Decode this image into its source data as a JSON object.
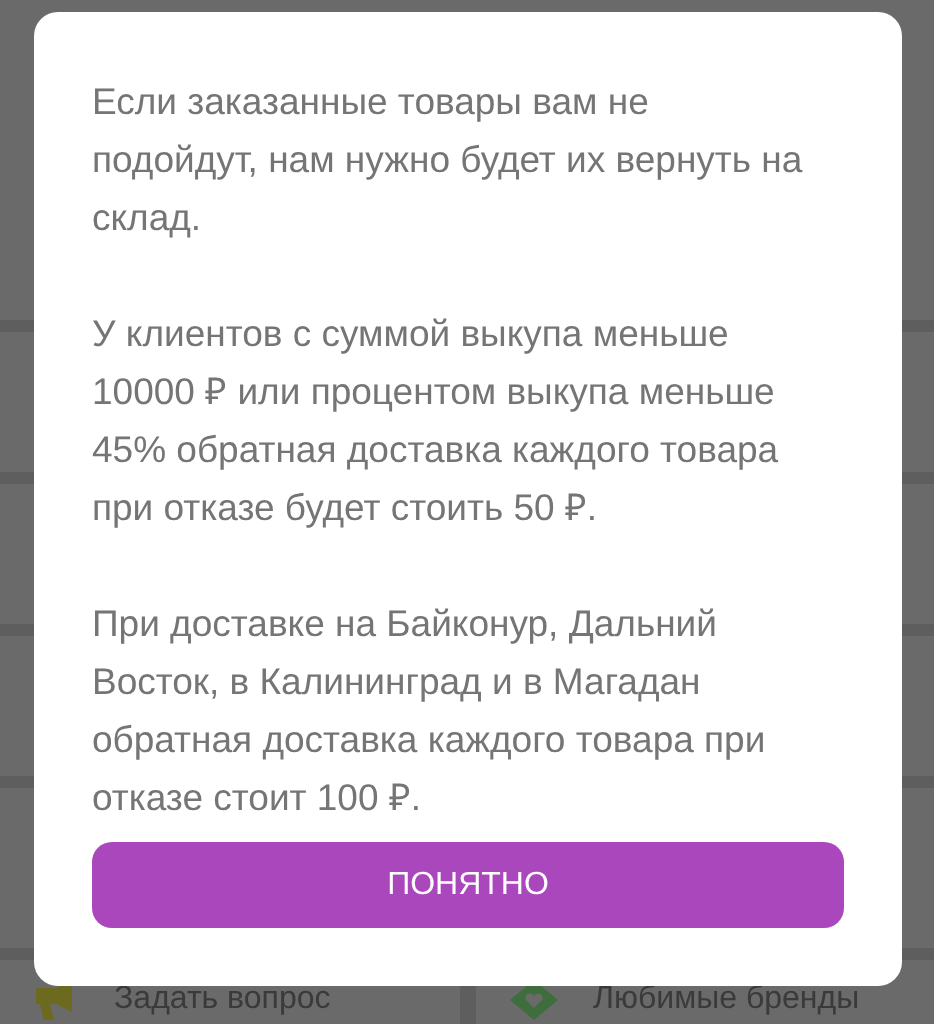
{
  "background_tiles": [
    {
      "label": "Задать вопрос"
    },
    {
      "label": "Любимые бренды"
    }
  ],
  "dialog": {
    "paragraphs": [
      "Если заказанные товары вам не подойдут, нам нужно будет их вернуть на склад.",
      "У клиентов с суммой выкупа меньше 10000 ₽ или процентом выкупа меньше 45% обратная доставка каждого товара при отказе будет стоить 50 ₽.",
      "При доставке на Байконур, Дальний Восток, в Калининград и в Магадан обратная доставка каждого товара при отказе стоит 100 ₽."
    ],
    "button": "ПОНЯТНО"
  }
}
